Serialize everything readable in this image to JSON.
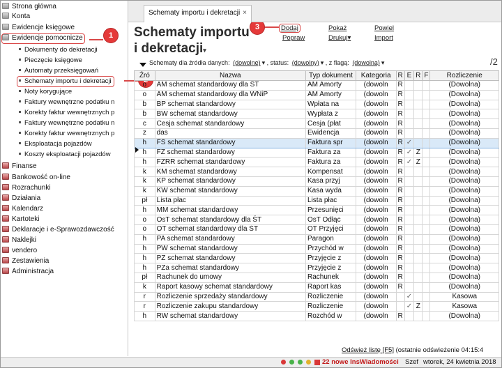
{
  "sidebar": {
    "items": [
      {
        "label": "Strona główna",
        "icon": "home-icon"
      },
      {
        "label": "Konta",
        "icon": "folder-icon"
      },
      {
        "label": "Ewidencje księgowe",
        "icon": "folder-icon"
      },
      {
        "label": "Ewidencje pomocnicze",
        "icon": "folder-icon"
      }
    ],
    "sub_items": [
      "Dokumenty do dekretacji",
      "Pieczęcie księgowe",
      "Automaty przeksięgowań",
      "Schematy importu i dekretacji",
      "Noty korygujące",
      "Faktury wewnętrzne podatku n",
      "Korekty faktur wewnętrznych p",
      "Faktury wewnętrzne podatku n",
      "Korekty faktur wewnętrznych p",
      "Eksploatacja pojazdów",
      "Koszty eksploatacji pojazdów"
    ],
    "lower_items": [
      "Finanse",
      "Bankowość on-line",
      "Rozrachunki",
      "Działania",
      "Kalendarz",
      "Kartoteki",
      "Deklaracje i e-Sprawozdawczość",
      "Naklejki",
      "vendero",
      "Zestawienia",
      "Administracja"
    ]
  },
  "callouts": [
    "1",
    "2",
    "3"
  ],
  "tab": {
    "label": "Schematy importu i dekretacji",
    "close": "×"
  },
  "page": {
    "title_line1": "Schematy importu",
    "title_line2": "i dekretacji"
  },
  "actions": {
    "dodaj": "Dodaj",
    "popraw": "Popraw",
    "pokaz": "Pokaż",
    "drukuj": "Drukuj",
    "powiel": "Powiel",
    "import": "Import"
  },
  "filters": {
    "label1": "Schematy dla źródła danych:",
    "val1": "(dowolne)",
    "label2": ", status:",
    "val2": "(dowolny)",
    "label3": ", z flagą:",
    "val3": "(dowolna)"
  },
  "pager": "/2",
  "table": {
    "headers": [
      "Źró",
      "Nazwa",
      "Typ dokument",
      "Kategoria",
      "R",
      "E",
      "R",
      "F",
      "Rozliczenie"
    ],
    "rows": [
      [
        "o",
        "AM schemat standardowy dla ŚT",
        "AM Amorty",
        "(dowoln",
        "R",
        "",
        "",
        "",
        "(Dowolna)"
      ],
      [
        "o",
        "AM schemat standardowy dla WNiP",
        "AM Amorty",
        "(dowoln",
        "R",
        "",
        "",
        "",
        "(Dowolna)"
      ],
      [
        "b",
        "BP schemat standardowy",
        "Wpłata na",
        "(dowoln",
        "R",
        "",
        "",
        "",
        "(Dowolna)"
      ],
      [
        "b",
        "BW schemat standardowy",
        "Wypłata z",
        "(dowoln",
        "R",
        "",
        "",
        "",
        "(Dowolna)"
      ],
      [
        "c",
        "Cesja schemat standardowy",
        "Cesja (płat",
        "(dowoln",
        "R",
        "",
        "",
        "",
        "(Dowolna)"
      ],
      [
        "z",
        "das",
        "Ewidencja",
        "(dowoln",
        "R",
        "",
        "",
        "",
        "(Dowolna)"
      ],
      [
        "h",
        "FS schemat standardowy",
        "Faktura spr",
        "(dowoln",
        "R",
        "✓",
        "",
        "",
        "(Dowolna)"
      ],
      [
        "h",
        "FZ schemat standardowy",
        "Faktura za",
        "(dowoln",
        "R",
        "✓",
        "Z",
        "",
        "(Dowolna)"
      ],
      [
        "h",
        "FZRR schemat standardowy",
        "Faktura za",
        "(dowoln",
        "R",
        "✓",
        "Z",
        "",
        "(Dowolna)"
      ],
      [
        "k",
        "KM schemat standardowy",
        "Kompensat",
        "(dowoln",
        "R",
        "",
        "",
        "",
        "(Dowolna)"
      ],
      [
        "k",
        "KP schemat standardowy",
        "Kasa przyj",
        "(dowoln",
        "R",
        "",
        "",
        "",
        "(Dowolna)"
      ],
      [
        "k",
        "KW schemat standardowy",
        "Kasa wyda",
        "(dowoln",
        "R",
        "",
        "",
        "",
        "(Dowolna)"
      ],
      [
        "pł",
        "Lista płac",
        "Lista płac",
        "(dowoln",
        "R",
        "",
        "",
        "",
        "(Dowolna)"
      ],
      [
        "h",
        "MM schemat standardowy",
        "Przesunięci",
        "(dowoln",
        "R",
        "",
        "",
        "",
        "(Dowolna)"
      ],
      [
        "o",
        "OsT schemat standardowy dla ŚT",
        "OsT Odłąc",
        "(dowoln",
        "R",
        "",
        "",
        "",
        "(Dowolna)"
      ],
      [
        "o",
        "OT schemat standardowy dla ŚT",
        "OT Przyjęci",
        "(dowoln",
        "R",
        "",
        "",
        "",
        "(Dowolna)"
      ],
      [
        "h",
        "PA schemat standardowy",
        "Paragon",
        "(dowoln",
        "R",
        "",
        "",
        "",
        "(Dowolna)"
      ],
      [
        "h",
        "PW schemat standardowy",
        "Przychód w",
        "(dowoln",
        "R",
        "",
        "",
        "",
        "(Dowolna)"
      ],
      [
        "h",
        "PZ schemat standardowy",
        "Przyjęcie z",
        "(dowoln",
        "R",
        "",
        "",
        "",
        "(Dowolna)"
      ],
      [
        "h",
        "PZa schemat standardowy",
        "Przyjęcie z",
        "(dowoln",
        "R",
        "",
        "",
        "",
        "(Dowolna)"
      ],
      [
        "pł",
        "Rachunek do umowy",
        "Rachunek",
        "(dowoln",
        "R",
        "",
        "",
        "",
        "(Dowolna)"
      ],
      [
        "k",
        "Raport kasowy schemat standardowy",
        "Raport kas",
        "(dowoln",
        "R",
        "",
        "",
        "",
        "(Dowolna)"
      ],
      [
        "r",
        "Rozliczenie sprzedaży standardowy",
        "Rozliczenie",
        "(dowoln",
        "",
        "✓",
        "",
        "",
        "Kasowa"
      ],
      [
        "r",
        "Rozliczenie zakupu standardowy",
        "Rozliczenie",
        "(dowoln",
        "",
        "✓",
        "Z",
        "",
        "Kasowa"
      ],
      [
        "h",
        "RW schemat standardowy",
        "Rozchód w",
        "(dowoln",
        "R",
        "",
        "",
        "",
        "(Dowolna)"
      ]
    ],
    "selected_row": 6
  },
  "refresh": {
    "link": "Odśwież listę [F5]",
    "rest": "(ostatnie odświeżenie 04:15:4"
  },
  "status": {
    "notice": "22 nowe InsWiadomości",
    "user": "Szef",
    "date": "wtorek, 24 kwietnia 2018"
  }
}
